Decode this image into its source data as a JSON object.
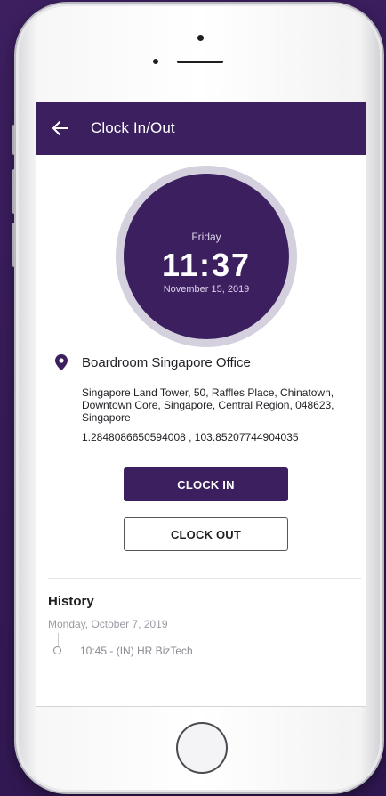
{
  "appbar": {
    "title": "Clock In/Out",
    "back_icon": "arrow-left-icon"
  },
  "clock": {
    "day": "Friday",
    "time": "11:37",
    "date": "November 15, 2019"
  },
  "location": {
    "icon": "map-pin-icon",
    "name": "Boardroom Singapore Office",
    "address": "Singapore Land Tower, 50, Raffles Place, Chinatown, Downtown Core, Singapore, Central Region, 048623, Singapore",
    "coordinates": "1.2848086650594008 , 103.85207744904035"
  },
  "actions": {
    "clock_in_label": "CLOCK IN",
    "clock_out_label": "CLOCK OUT"
  },
  "history": {
    "title": "History",
    "date": "Monday, October 7, 2019",
    "entries": [
      {
        "text": "10:45 - (IN) HR BizTech"
      }
    ]
  },
  "colors": {
    "brand": "#3c1f5e",
    "clock_ring": "#d5d0de",
    "background": "#3a1d5c"
  }
}
